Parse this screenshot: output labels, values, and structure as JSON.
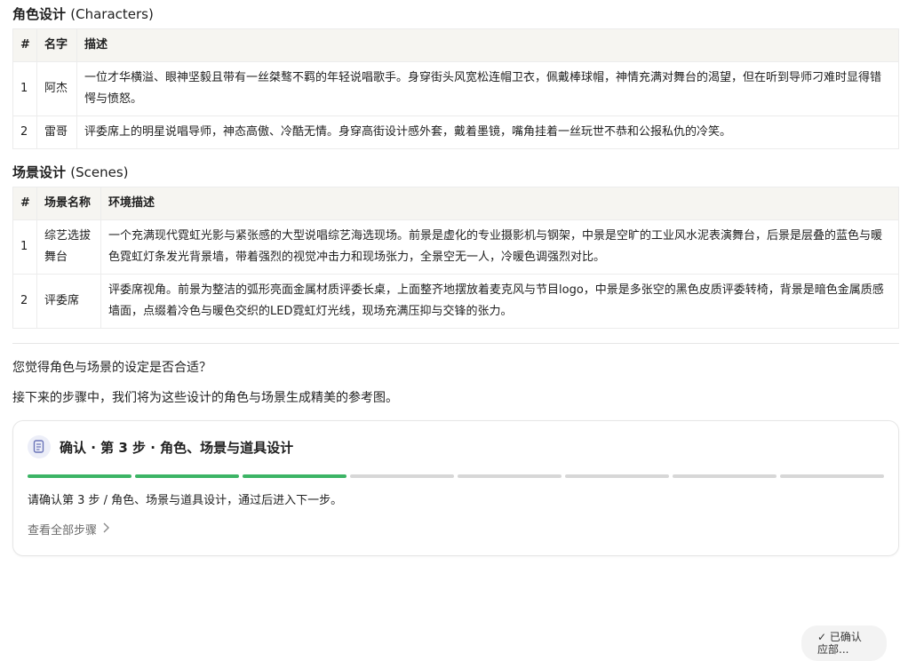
{
  "characters": {
    "title_cn": "角色设计",
    "title_en": "(Characters)",
    "headers": [
      "#",
      "名字",
      "描述"
    ],
    "rows": [
      [
        "1",
        "阿杰",
        "一位才华横溢、眼神坚毅且带有一丝桀骜不羁的年轻说唱歌手。身穿街头风宽松连帽卫衣，佩戴棒球帽，神情充满对舞台的渴望，但在听到导师刁难时显得错愕与愤怒。"
      ],
      [
        "2",
        "雷哥",
        "评委席上的明星说唱导师，神态高傲、冷酷无情。身穿高街设计感外套，戴着墨镜，嘴角挂着一丝玩世不恭和公报私仇的冷笑。"
      ]
    ]
  },
  "scenes": {
    "title_cn": "场景设计",
    "title_en": "(Scenes)",
    "headers": [
      "#",
      "场景名称",
      "环境描述"
    ],
    "rows": [
      [
        "1",
        "综艺选拔舞台",
        "一个充满现代霓虹光影与紧张感的大型说唱综艺海选现场。前景是虚化的专业摄影机与钢架，中景是空旷的工业风水泥表演舞台，后景是层叠的蓝色与暖色霓虹灯条发光背景墙，带着强烈的视觉冲击力和现场张力，全景空无一人，冷暖色调强烈对比。"
      ],
      [
        "2",
        "评委席",
        "评委席视角。前景为整洁的弧形亮面金属材质评委长桌，上面整齐地摆放着麦克风与节目logo，中景是多张空的黑色皮质评委转椅，背景是暗色金属质感墙面，点缀着冷色与暖色交织的LED霓虹灯光线，现场充满压抑与交锋的张力。"
      ]
    ]
  },
  "question": "您觉得角色与场景的设定是否合适？",
  "next_step_text": "接下来的步骤中，我们将为这些设计的角色与场景生成精美的参考图。",
  "confirm_card": {
    "icon": "document-icon",
    "title": "确认 · 第 3 步 · 角色、场景与道具设计",
    "progress_total": 8,
    "progress_done": 3,
    "description": "请确认第 3 步 / 角色、场景与道具设计，通过后进入下一步。",
    "view_all_label": "查看全部步骤"
  },
  "floating_button": {
    "line1": "✓ 已确认",
    "line2": "应部..."
  },
  "colors": {
    "accent": "#3cb465",
    "header_bg": "#f6f5f1"
  }
}
